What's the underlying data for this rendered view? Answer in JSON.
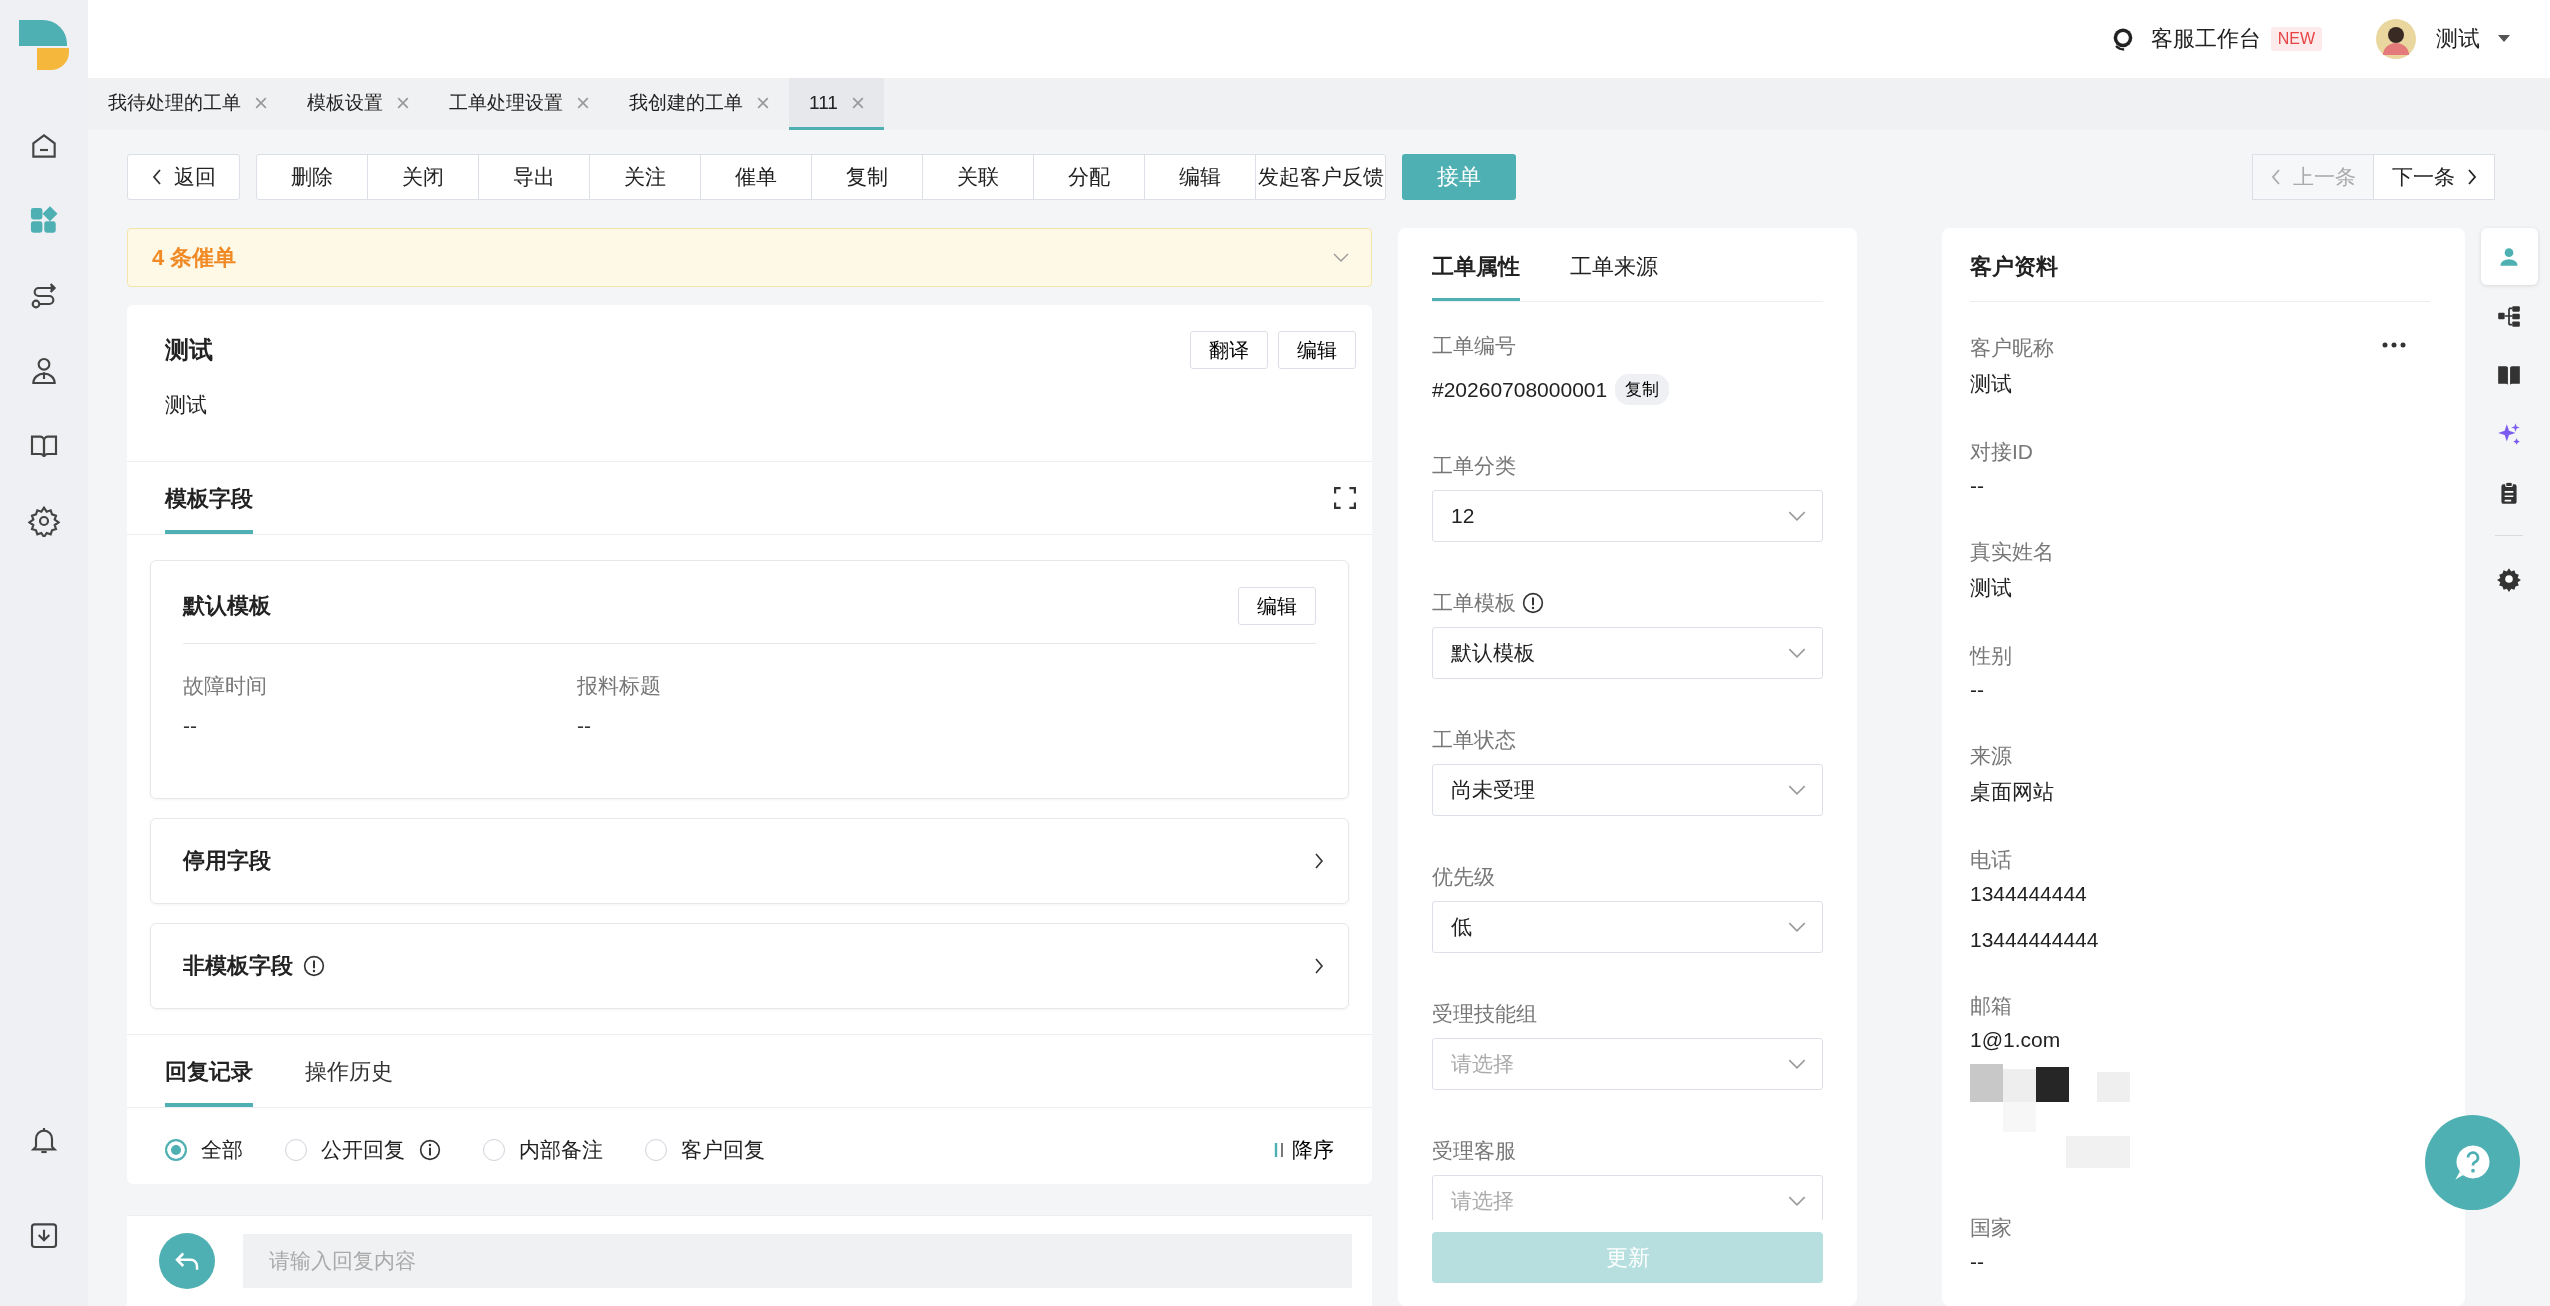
{
  "header": {
    "workbench": {
      "label": "客服工作台",
      "badge": "NEW"
    },
    "user": {
      "name": "测试"
    }
  },
  "nav": [
    {
      "selected": false
    },
    {
      "selected": true
    },
    {
      "selected": false
    },
    {
      "selected": false
    },
    {
      "selected": false
    },
    {
      "selected": false
    }
  ],
  "nav_bottom": [
    {
      "selected": false
    },
    {
      "selected": false
    }
  ],
  "tabs": [
    {
      "label": "我待处理的工单",
      "selected": false
    },
    {
      "label": "模板设置",
      "selected": false
    },
    {
      "label": "工单处理设置",
      "selected": false
    },
    {
      "label": "我创建的工单",
      "selected": false
    },
    {
      "label": "111",
      "selected": true
    }
  ],
  "toolbar": {
    "back": "返回",
    "actions": [
      "删除",
      "关闭",
      "导出",
      "关注",
      "催单",
      "复制",
      "关联",
      "分配",
      "编辑",
      "发起客户反馈"
    ],
    "primary": "接单",
    "prev": {
      "label": "上一条",
      "disabled": true
    },
    "next": {
      "label": "下一条",
      "disabled": false
    }
  },
  "reminder": {
    "text": "4 条催单"
  },
  "ticket": {
    "title": "测试",
    "body": "测试",
    "buttons": [
      "翻译",
      "编辑"
    ]
  },
  "field_tabs": [
    {
      "label": "模板字段",
      "selected": true
    }
  ],
  "template": {
    "name": "默认模板",
    "edit": "编辑",
    "fields": [
      {
        "label": "故障时间",
        "value": "--"
      },
      {
        "label": "报料标题",
        "value": "--"
      }
    ]
  },
  "sections": [
    {
      "label": "停用字段",
      "info": false
    },
    {
      "label": "非模板字段",
      "info": true
    }
  ],
  "record_tabs": [
    {
      "label": "回复记录",
      "selected": true
    },
    {
      "label": "操作历史",
      "selected": false
    }
  ],
  "filters": [
    {
      "label": "全部",
      "selected": true,
      "info": false
    },
    {
      "label": "公开回复",
      "selected": false,
      "info": true
    },
    {
      "label": "内部备注",
      "selected": false,
      "info": false
    },
    {
      "label": "客户回复",
      "selected": false,
      "info": false
    }
  ],
  "sort": "降序",
  "reply": {
    "placeholder": "请输入回复内容"
  },
  "properties": {
    "tabs": [
      {
        "label": "工单属性",
        "selected": true
      },
      {
        "label": "工单来源",
        "selected": false
      }
    ],
    "number_label": "工单编号",
    "number": "#20260708000001",
    "copy": "复制",
    "fields": [
      {
        "label": "工单分类",
        "value": "12",
        "info": false
      },
      {
        "label": "工单模板",
        "value": "默认模板",
        "info": true
      },
      {
        "label": "工单状态",
        "value": "尚未受理",
        "info": false
      },
      {
        "label": "优先级",
        "value": "低",
        "info": false
      },
      {
        "label": "受理技能组",
        "placeholder": "请选择",
        "info": false
      },
      {
        "label": "受理客服",
        "placeholder": "请选择",
        "info": false
      }
    ],
    "update": {
      "label": "更新",
      "disabled": true
    }
  },
  "customer": {
    "title": "客户资料",
    "fields": [
      {
        "label": "客户昵称",
        "values": [
          "测试"
        ]
      },
      {
        "label": "对接ID",
        "values": [
          "--"
        ]
      },
      {
        "label": "真实姓名",
        "values": [
          "测试"
        ]
      },
      {
        "label": "性别",
        "values": [
          "--"
        ]
      },
      {
        "label": "来源",
        "values": [
          "桌面网站"
        ]
      },
      {
        "label": "电话",
        "values": [
          "1344444444",
          "13444444444"
        ]
      },
      {
        "label": "邮箱",
        "values": [
          "1@1.com"
        ],
        "attachment": {
          "kind": "picture"
        }
      },
      {
        "label": "国家",
        "values": [
          "--"
        ]
      }
    ]
  },
  "right_rail": [
    {
      "selected": true
    },
    {
      "selected": false
    },
    {
      "selected": false
    },
    {
      "selected": false
    },
    {
      "selected": false
    },
    {
      "selected": false
    }
  ]
}
